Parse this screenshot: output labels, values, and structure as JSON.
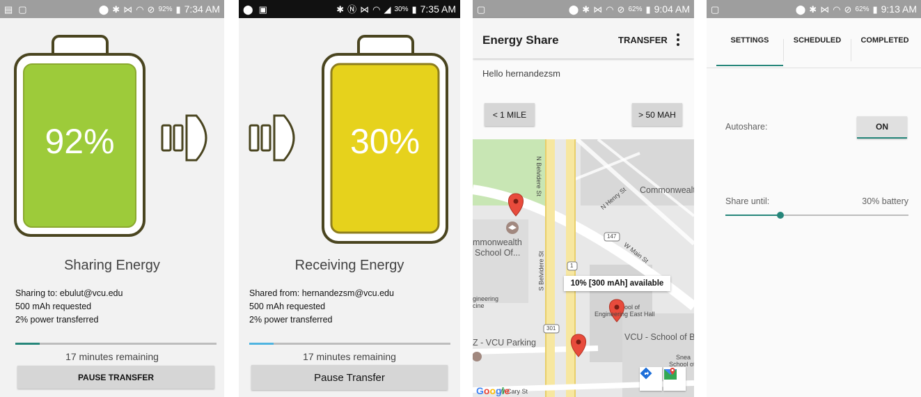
{
  "colors": {
    "battery_green": "#9dcb3a",
    "battery_yellow": "#e6d21c",
    "outline": "#4a4520",
    "teal": "#26867a",
    "light_blue": "#4fb4e0",
    "pin_red": "#e84b3c"
  },
  "screen1": {
    "status": {
      "battery": "92%",
      "time": "7:34 AM"
    },
    "battery_percent": "92%",
    "battery_level": 0.92,
    "title": "Sharing Energy",
    "lines": [
      "Sharing to: ebulut@vcu.edu",
      "500 mAh requested",
      "2% power transferred"
    ],
    "progress": 0.12,
    "remaining": "17 minutes remaining",
    "button": "PAUSE TRANSFER"
  },
  "screen2": {
    "status": {
      "battery": "30%",
      "time": "7:35 AM"
    },
    "battery_percent": "30%",
    "battery_level": 0.3,
    "title": "Receiving Energy",
    "lines": [
      "Shared from: hernandezsm@vcu.edu",
      "500 mAh requested",
      "2% power transferred"
    ],
    "progress": 0.12,
    "remaining": "17 minutes remaining",
    "button": "Pause Transfer"
  },
  "screen3": {
    "status": {
      "battery": "62%",
      "time": "9:04 AM"
    },
    "app_title": "Energy Share",
    "action": "TRANSFER",
    "greeting": "Hello hernandezsm",
    "filter_distance": "< 1 MILE",
    "filter_capacity": "> 50 MAH",
    "map": {
      "streets": [
        "N Belvidere St",
        "S Belvidere St",
        "N Henry St",
        "W Main St"
      ],
      "shields": [
        "147",
        "1",
        "301"
      ],
      "labels": {
        "commonwealth_top": "Commonwealt",
        "commonwealth_left_1": "mmonwealth",
        "commonwealth_left_2": "School Of...",
        "engineering_1": "gineering",
        "engineering_2": "cine",
        "east_hall_1": "ool of",
        "east_hall_2": "Engineering East Hall",
        "vcu_parking": "Z - VCU Parking",
        "vcu_school": "VCU - School of Bu",
        "snead_1": "Snea",
        "snead_2": "School of",
        "cary_st": "W Cary St"
      },
      "info_window": "10% [300 mAh] available",
      "google": [
        "G",
        "o",
        "o",
        "g",
        "l",
        "e"
      ]
    }
  },
  "screen4": {
    "status": {
      "battery": "62%",
      "time": "9:13 AM"
    },
    "tabs": [
      "SETTINGS",
      "SCHEDULED",
      "COMPLETED"
    ],
    "autoshare_label": "Autoshare:",
    "autoshare_value": "ON",
    "share_until_label": "Share until:",
    "share_until_value": "30% battery",
    "share_until_level": 0.3
  }
}
